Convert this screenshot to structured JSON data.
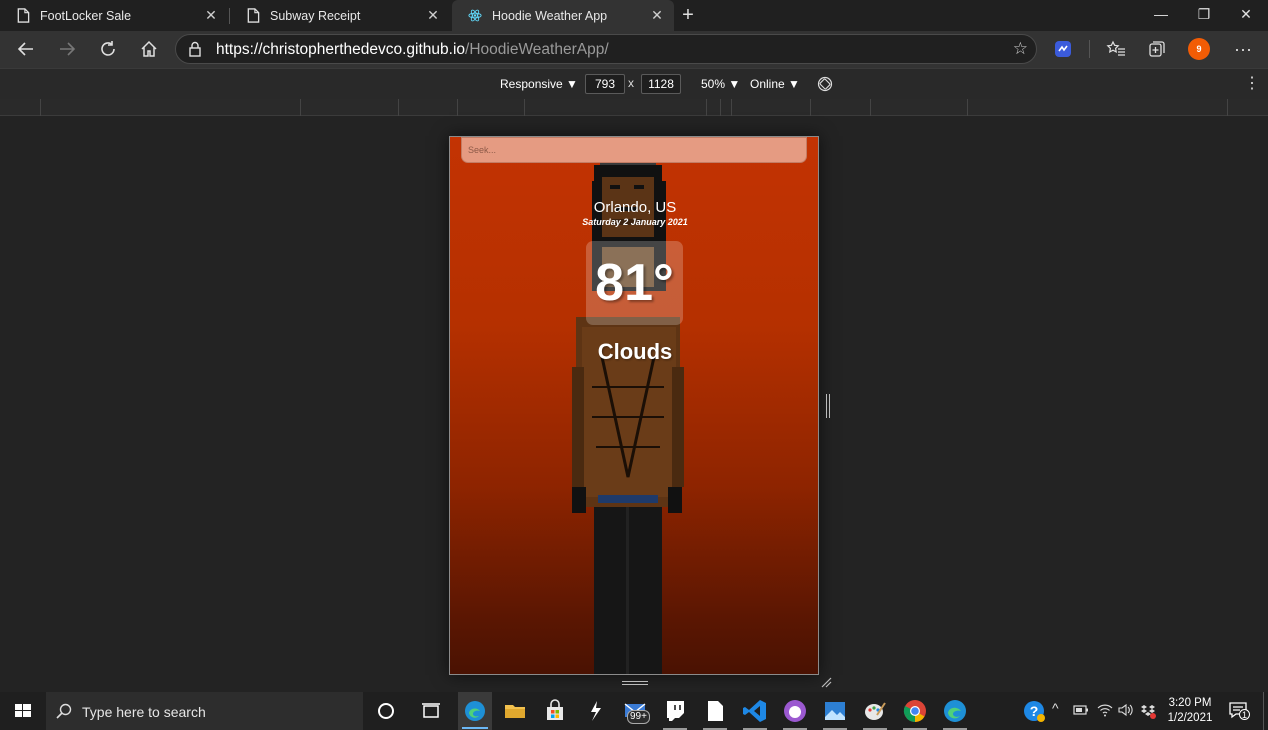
{
  "browser": {
    "tabs": [
      {
        "title": "FootLocker Sale",
        "icon": "page-icon",
        "active": false
      },
      {
        "title": "Subway Receipt",
        "icon": "page-icon",
        "active": false
      },
      {
        "title": "Hoodie Weather App",
        "icon": "react-icon",
        "active": true
      }
    ],
    "window_controls": {
      "minimize": "—",
      "restore": "❐",
      "close": "✕"
    },
    "url_host": "https://christopherthedevco.github.io",
    "url_path": "/HoodieWeatherApp/",
    "profile_initial": "9"
  },
  "devtools": {
    "device_mode": "Responsive ▼",
    "width": "793",
    "height": "1128",
    "separator": "x",
    "zoom": "50% ▼",
    "throttle": "Online ▼"
  },
  "app": {
    "search_placeholder": "Seek...",
    "location": "Orlando, US",
    "date": "Saturday 2 January 2021",
    "temperature": "81°",
    "condition": "Clouds",
    "colors": {
      "bg_top": "#c33303",
      "bg_bottom": "#4a1202",
      "search_bg": "#e59b82"
    }
  },
  "taskbar": {
    "search_placeholder": "Type here to search",
    "mail_badge": "99+",
    "time": "3:20 PM",
    "date": "1/2/2021",
    "notification_count": "1"
  }
}
